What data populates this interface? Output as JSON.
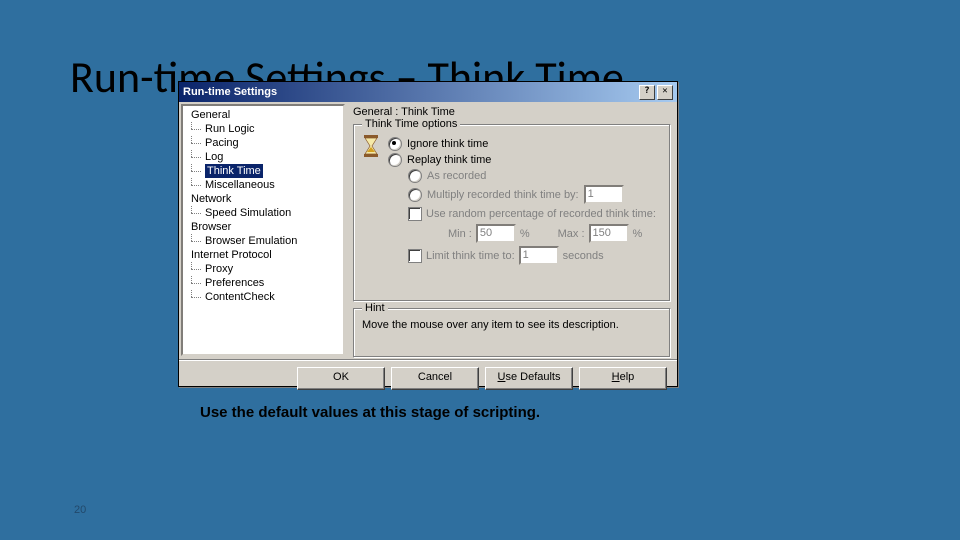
{
  "slide": {
    "title": "Run-time Settings – Think Time",
    "caption": "Use the default values at this stage of scripting.",
    "number": "20"
  },
  "dialog": {
    "title": "Run-time Settings",
    "panel_title": "General : Think Time",
    "groupbox_title": "Think Time options",
    "radio_ignore": "Ignore think time",
    "radio_replay": "Replay think time",
    "radio_asrecorded": "As recorded",
    "radio_multiply": "Multiply recorded think time by:",
    "multiply_val": "1",
    "chk_random": "Use random percentage of recorded think time:",
    "min_label": "Min :",
    "min_val": "50",
    "max_label": "Max :",
    "max_val": "150",
    "pct": "%",
    "chk_limit": "Limit think time to:",
    "limit_val": "1",
    "seconds": "seconds",
    "hint_title": "Hint",
    "hint_text": "Move the mouse over any item to see its description.",
    "btn_ok": "OK",
    "btn_cancel": "Cancel",
    "btn_defaults_pre": "U",
    "btn_defaults_rest": "se Defaults",
    "btn_help_pre": "H",
    "btn_help_rest": "elp"
  },
  "tree": {
    "g_general": "General",
    "run_logic": "Run Logic",
    "pacing": "Pacing",
    "log": "Log",
    "think_time": "Think Time",
    "misc": "Miscellaneous",
    "g_network": "Network",
    "speed": "Speed Simulation",
    "g_browser": "Browser",
    "browser_emu": "Browser Emulation",
    "g_ip": "Internet Protocol",
    "proxy": "Proxy",
    "prefs": "Preferences",
    "content": "ContentCheck"
  }
}
